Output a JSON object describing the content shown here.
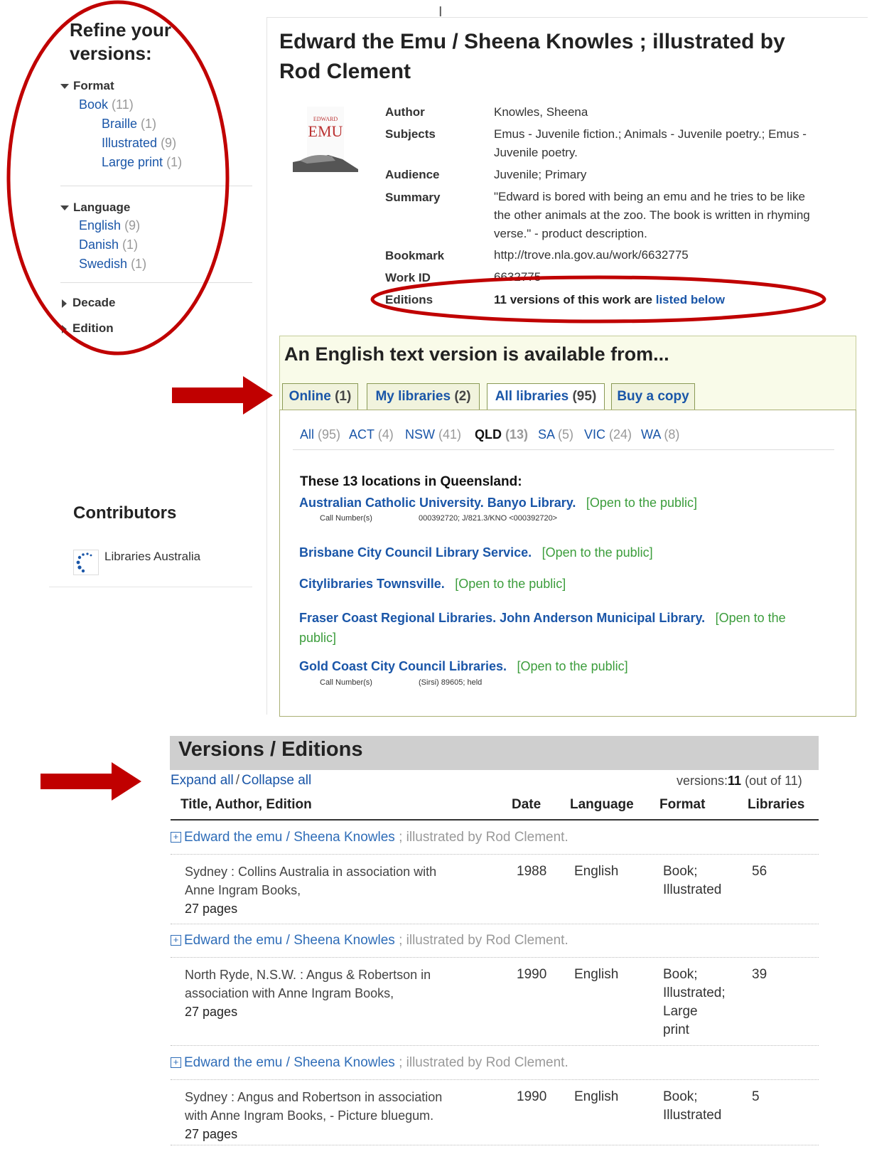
{
  "refine": {
    "title_line1": "Refine your",
    "title_line2": "versions:",
    "format": {
      "heading": "Format",
      "book": {
        "label": "Book",
        "count": "(11)"
      },
      "sub": [
        {
          "label": "Braille",
          "count": "(1)"
        },
        {
          "label": "Illustrated",
          "count": "(9)"
        },
        {
          "label": "Large print",
          "count": "(1)"
        }
      ]
    },
    "language": {
      "heading": "Language",
      "items": [
        {
          "label": "English",
          "count": "(9)"
        },
        {
          "label": "Danish",
          "count": "(1)"
        },
        {
          "label": "Swedish",
          "count": "(1)"
        }
      ]
    },
    "decade": "Decade",
    "edition": "Edition"
  },
  "work": {
    "title_line1": "Edward the Emu / Sheena Knowles ; illustrated by",
    "title_line2": "Rod Clement",
    "cover_text_top": "EDWARD",
    "cover_text_mid": "EMU",
    "author_label": "Author",
    "author_value": "Knowles, Sheena",
    "subjects_label": "Subjects",
    "subjects_value_line1": "Emus - Juvenile fiction.; Animals - Juvenile poetry.; Emus -",
    "subjects_value_line2": "Juvenile poetry.",
    "audience_label": "Audience",
    "audience_value": "Juvenile; Primary",
    "summary_label": "Summary",
    "summary_line1": "\"Edward is bored with being an emu and he tries to be like",
    "summary_line2": "the other animals at the zoo. The book is written in rhyming",
    "summary_line3": "verse.\" - product description.",
    "bookmark_label": "Bookmark",
    "bookmark_value": "http://trove.nla.gov.au/work/6632775",
    "workid_label": "Work ID",
    "workid_value": "6632775",
    "editions_label": "Editions",
    "editions_text": "11 versions of this work are",
    "editions_link": "listed below"
  },
  "availability": {
    "title": "An English text version is available from...",
    "tabs": [
      {
        "label": "Online",
        "count": "(1)"
      },
      {
        "label": "My libraries",
        "count": "(2)"
      },
      {
        "label": "All libraries",
        "count": "(95)"
      },
      {
        "label": "Buy a copy",
        "count": ""
      }
    ],
    "states": [
      {
        "label": "All",
        "count": "(95)"
      },
      {
        "label": "ACT",
        "count": "(4)"
      },
      {
        "label": "NSW",
        "count": "(41)"
      },
      {
        "label": "QLD",
        "count": "(13)"
      },
      {
        "label": "SA",
        "count": "(5)"
      },
      {
        "label": "VIC",
        "count": "(24)"
      },
      {
        "label": "WA",
        "count": "(8)"
      }
    ],
    "locations_heading": "These 13 locations in Queensland:",
    "open_text": "[Open to the public]",
    "call_label": "Call Number(s)",
    "locations": [
      {
        "name": "Australian Catholic University. Banyo Library.",
        "call": "000392720; J/821.3/KNO <000392720>"
      },
      {
        "name": "Brisbane City Council Library Service."
      },
      {
        "name": "Citylibraries Townsville."
      },
      {
        "name": "Fraser Coast Regional Libraries. John Anderson Municipal Library.",
        "open_part1": "[Open to the",
        "open_part2": "public]"
      },
      {
        "name": "Gold Coast City Council Libraries.",
        "call": "(Sirsi) 89605; held"
      }
    ]
  },
  "contributors": {
    "title": "Contributors",
    "items": [
      {
        "label": "Libraries Australia"
      }
    ]
  },
  "versions": {
    "title": "Versions / Editions",
    "expand": "Expand all",
    "slash": "/",
    "collapse": "Collapse all",
    "count_label": "versions:",
    "count_value": "11",
    "count_total": "(out of 11)",
    "columns": [
      "Title, Author, Edition",
      "Date",
      "Language",
      "Format",
      "Libraries"
    ],
    "rows": [
      {
        "title_a": "Edward the emu / Sheena Knowles",
        "title_b": "; illustrated by Rod Clement.",
        "pub_lines": [
          "Sydney : Collins Australia in association with",
          "Anne Ingram Books,",
          "27 pages"
        ],
        "date": "1988",
        "language": "English",
        "format_lines": [
          "Book;",
          "Illustrated"
        ],
        "libraries": "56"
      },
      {
        "title_a": "Edward the emu / Sheena Knowles",
        "title_b": "; illustrated by Rod Clement.",
        "pub_lines": [
          "North Ryde, N.S.W. : Angus & Robertson in",
          "association with Anne Ingram Books,",
          "27 pages"
        ],
        "date": "1990",
        "language": "English",
        "format_lines": [
          "Book;",
          "Illustrated;",
          "Large",
          "print"
        ],
        "libraries": "39"
      },
      {
        "title_a": "Edward the emu / Sheena Knowles",
        "title_b": "; illustrated by Rod Clement.",
        "pub_lines": [
          "Sydney : Angus and Robertson in association",
          "with Anne Ingram Books, - Picture bluegum.",
          "27 pages"
        ],
        "date": "1990",
        "language": "English",
        "format_lines": [
          "Book;",
          "Illustrated"
        ],
        "libraries": "5"
      }
    ]
  },
  "colors": {
    "annotation_red": "#c00000",
    "link_blue": "#1a56a8",
    "open_green": "#3c9d3c"
  }
}
